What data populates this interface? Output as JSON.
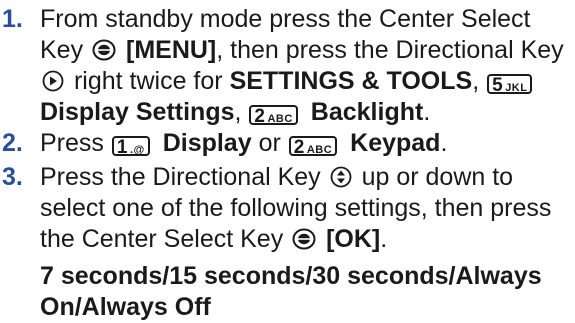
{
  "steps": [
    {
      "number": "1.",
      "t1": "From standby mode press the Center Select",
      "t2": "Key",
      "menu": "[MENU]",
      "t3": ", then press the Directional Key",
      "t4": "right twice for",
      "settings_tools": "SETTINGS & TOOLS",
      "t5": ",",
      "key5": {
        "digit": "5",
        "letters": "JKL"
      },
      "display_settings": "Display Settings",
      "t6": ",",
      "key2": {
        "digit": "2",
        "letters": "ABC"
      },
      "backlight": "Backlight",
      "t7": "."
    },
    {
      "number": "2.",
      "t1": "Press",
      "key1": {
        "digit": "1",
        "letters": ".@"
      },
      "display": "Display",
      "or": "or",
      "key2": {
        "digit": "2",
        "letters": "ABC"
      },
      "keypad": "Keypad",
      "t2": "."
    },
    {
      "number": "3.",
      "t1": "Press the Directional Key",
      "t2": "up or down to",
      "t3": "select one of the following settings, then press",
      "t4": "the Center Select Key",
      "ok": "[OK]",
      "t5": ".",
      "options_line1": "7 seconds/15 seconds/30 seconds/Always",
      "options_line2": "On/Always Off"
    }
  ],
  "icons": [
    "center-select-key-icon",
    "directional-key-right-icon",
    "directional-key-updown-icon"
  ],
  "colors": {
    "step_number": "#2a4e9a",
    "text": "#1a1a1a"
  }
}
